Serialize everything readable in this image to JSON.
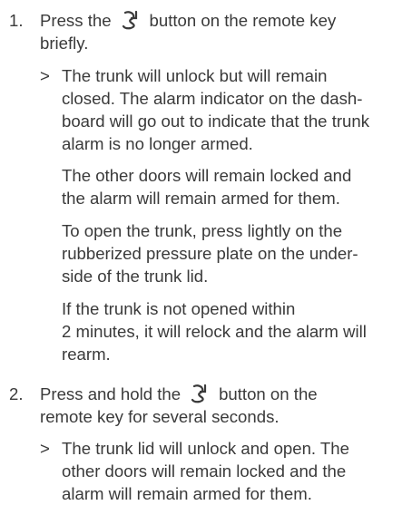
{
  "steps": [
    {
      "number": "1.",
      "instruction_before_icon": "Press the",
      "instruction_after_icon": "button on the remote key",
      "instruction_line2": "briefly.",
      "icon": "trunk-open-icon",
      "result_marker": ">",
      "result_lines": [
        "The trunk will unlock but will remain",
        "closed. The alarm indicator on the dash-",
        "board will go out to indicate that the trunk",
        "alarm is no longer armed."
      ],
      "paragraphs": [
        [
          "The other doors will remain locked and",
          "the alarm will remain armed for them."
        ],
        [
          "To open the trunk, press lightly on the",
          "rubberized pressure plate on the under-",
          "side of the trunk lid."
        ],
        [
          "If the trunk is not opened within",
          "2 minutes, it will relock and the alarm will",
          "rearm."
        ]
      ]
    },
    {
      "number": "2.",
      "instruction_before_icon": "Press and hold the",
      "instruction_after_icon": "button on the",
      "instruction_line2": "remote key for several seconds.",
      "icon": "trunk-open-icon",
      "result_marker": ">",
      "result_lines": [
        "The trunk lid will unlock and open. The",
        "other doors will remain locked and the",
        "alarm will remain armed for them."
      ]
    }
  ]
}
